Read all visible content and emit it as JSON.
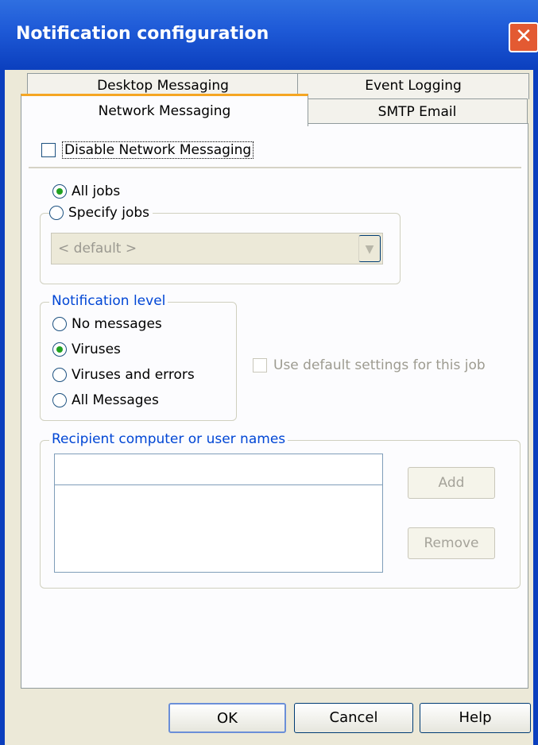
{
  "window": {
    "title": "Notification configuration"
  },
  "tabs": {
    "row1": [
      "Desktop Messaging",
      "Event Logging"
    ],
    "row2": [
      "Network Messaging",
      "SMTP Email"
    ]
  },
  "disable_checkbox": {
    "label": "Disable Network Messaging",
    "checked": false
  },
  "jobs": {
    "all_jobs_label": "All jobs",
    "specify_jobs_label": "Specify jobs",
    "selected": "All jobs",
    "combo_value": "< default >"
  },
  "notification_level": {
    "legend": "Notification level",
    "options": [
      "No messages",
      "Viruses",
      "Viruses and errors",
      "All Messages"
    ],
    "selected": "Viruses"
  },
  "use_default": {
    "label": "Use default settings for this job",
    "checked": false
  },
  "recipients": {
    "legend": "Recipient computer or user names",
    "input_value": "",
    "add_label": "Add",
    "remove_label": "Remove"
  },
  "footer": {
    "ok_label": "OK",
    "cancel_label": "Cancel",
    "help_label": "Help"
  },
  "colors": {
    "title_bar": "#1f5bd8",
    "close_button": "#e35a32",
    "legend_text": "#0046d5",
    "radio_dot": "#21a121",
    "active_tab_accent": "#f5a623"
  }
}
